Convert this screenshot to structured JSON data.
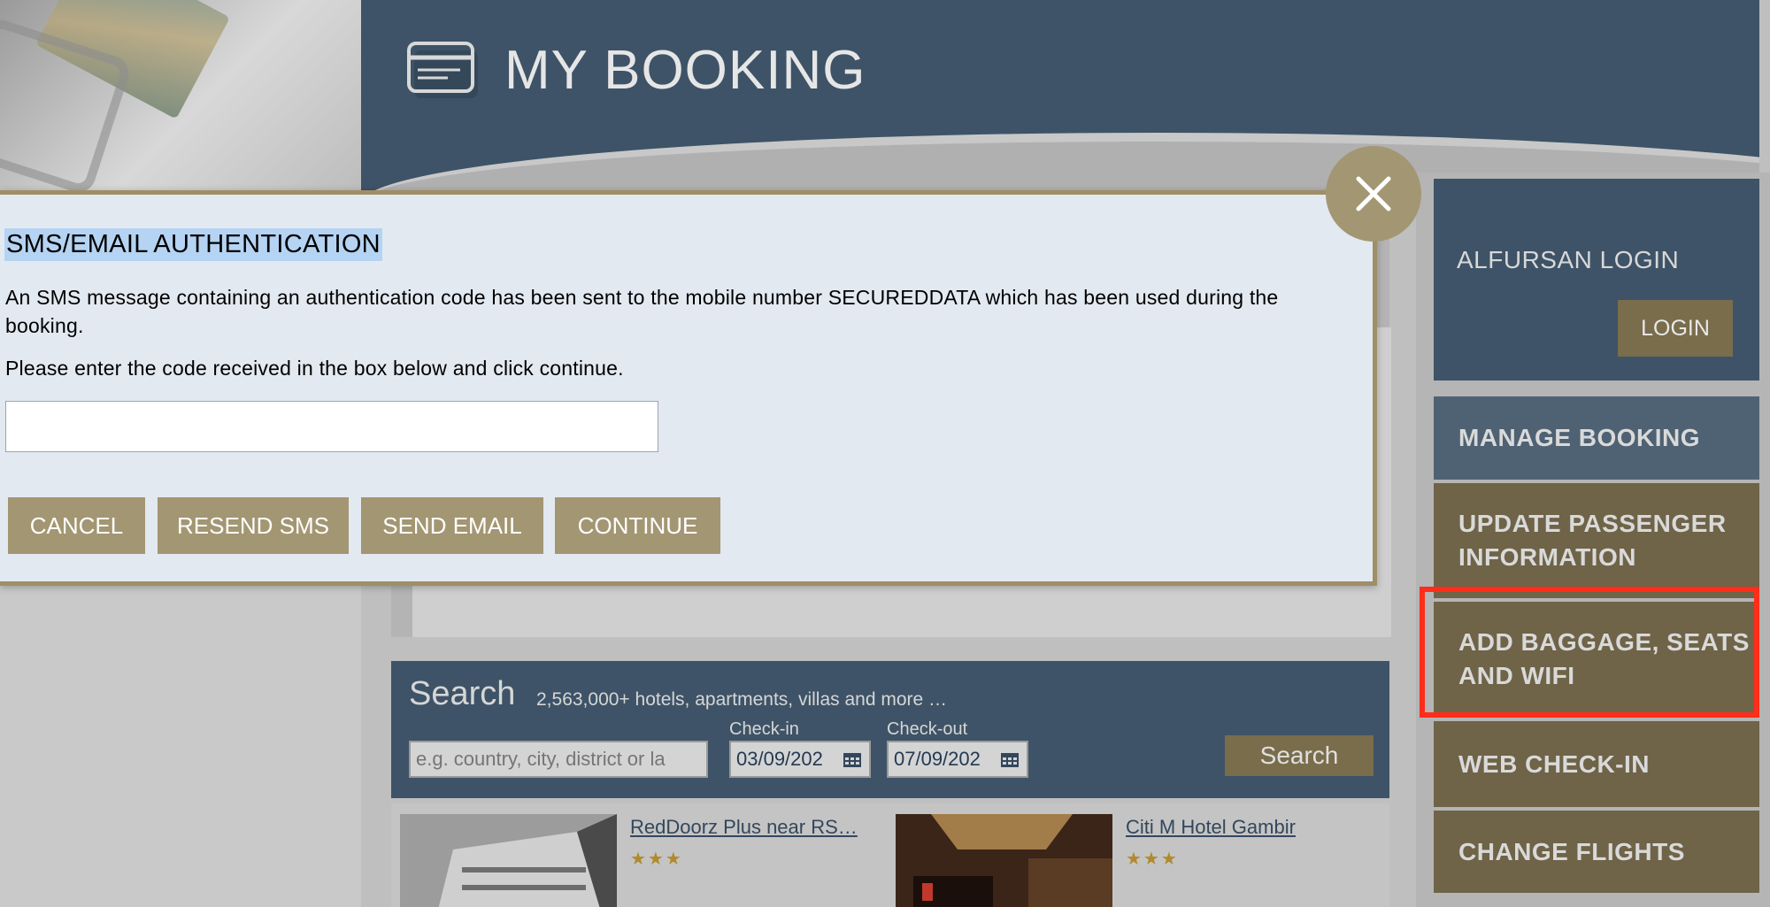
{
  "header": {
    "title": "MY BOOKING"
  },
  "sidebar": {
    "login_title": "ALFURSAN LOGIN",
    "login_button": "LOGIN",
    "menu": [
      "MANAGE BOOKING",
      "UPDATE PASSENGER INFORMATION",
      "ADD BAGGAGE, SEATS AND WIFI",
      "WEB CHECK-IN",
      "CHANGE FLIGHTS"
    ]
  },
  "search": {
    "title": "Search",
    "subtitle": "2,563,000+ hotels, apartments, villas and more …",
    "placeholder": "e.g. country, city, district or la",
    "checkin_label": "Check-in",
    "checkin_value": "03/09/202",
    "checkout_label": "Check-out",
    "checkout_value": "07/09/202",
    "button": "Search"
  },
  "hotels": [
    {
      "name": "RedDoorz Plus near RS…",
      "stars": "★★★"
    },
    {
      "name": "Citi M Hotel Gambir",
      "stars": "★★★"
    }
  ],
  "modal": {
    "title": "SMS/EMAIL AUTHENTICATION",
    "message": "An SMS message containing an authentication code has been sent to the mobile number SECUREDDATA which has been used during the booking.",
    "instruction": "Please enter the code received in the box below and click continue.",
    "code_value": "",
    "buttons": {
      "cancel": "CANCEL",
      "resend_sms": "RESEND SMS",
      "send_email": "SEND EMAIL",
      "continue": "CONTINUE"
    }
  },
  "colors": {
    "navy": "#3e5367",
    "gold": "#a39672",
    "highlight": "#ff2d1a"
  }
}
